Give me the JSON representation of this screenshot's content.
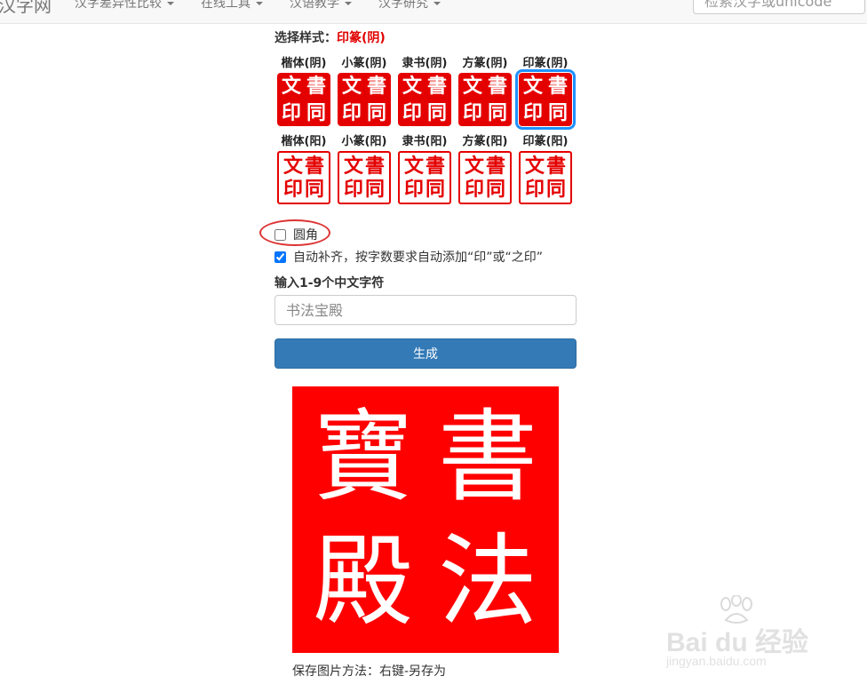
{
  "navbar": {
    "brand": "汉字网",
    "menus": [
      {
        "label": "汉字差异性比较"
      },
      {
        "label": "在线工具"
      },
      {
        "label": "汉语教学"
      },
      {
        "label": "汉字研究"
      }
    ],
    "search_placeholder": "检索汉字或unicode"
  },
  "style_chooser": {
    "label": "选择样式：",
    "current_style": "印篆(阴)",
    "seal_chars": [
      "書",
      "同",
      "文",
      "印"
    ],
    "rows": [
      {
        "type": "yin",
        "styles": [
          {
            "name": "楷体(阴)",
            "selected": false
          },
          {
            "name": "小篆(阴)",
            "selected": false
          },
          {
            "name": "隶书(阴)",
            "selected": false
          },
          {
            "name": "方篆(阴)",
            "selected": false
          },
          {
            "name": "印篆(阴)",
            "selected": true
          }
        ]
      },
      {
        "type": "yang",
        "styles": [
          {
            "name": "楷体(阳)",
            "selected": false
          },
          {
            "name": "小篆(阳)",
            "selected": false
          },
          {
            "name": "隶书(阳)",
            "selected": false
          },
          {
            "name": "方篆(阳)",
            "selected": false
          },
          {
            "name": "印篆(阳)",
            "selected": false
          }
        ]
      }
    ]
  },
  "options": {
    "rounded_label": "圆角",
    "rounded_checked": false,
    "autofill_label": "自动补齐，按字数要求自动添加“印”或“之印”",
    "autofill_checked": true
  },
  "input": {
    "label": "输入1-9个中文字符",
    "placeholder": "书法宝殿",
    "value": ""
  },
  "generate_button": "生成",
  "result": {
    "chars": [
      "書",
      "法",
      "寶",
      "殿"
    ],
    "background": "#ff0000",
    "save_hint": "保存图片方法：右键-另存为"
  },
  "annotation": {
    "color": "#dd3333"
  },
  "watermark": {
    "logo": "Bai du 经验",
    "url": "jingyan.baidu.com"
  }
}
